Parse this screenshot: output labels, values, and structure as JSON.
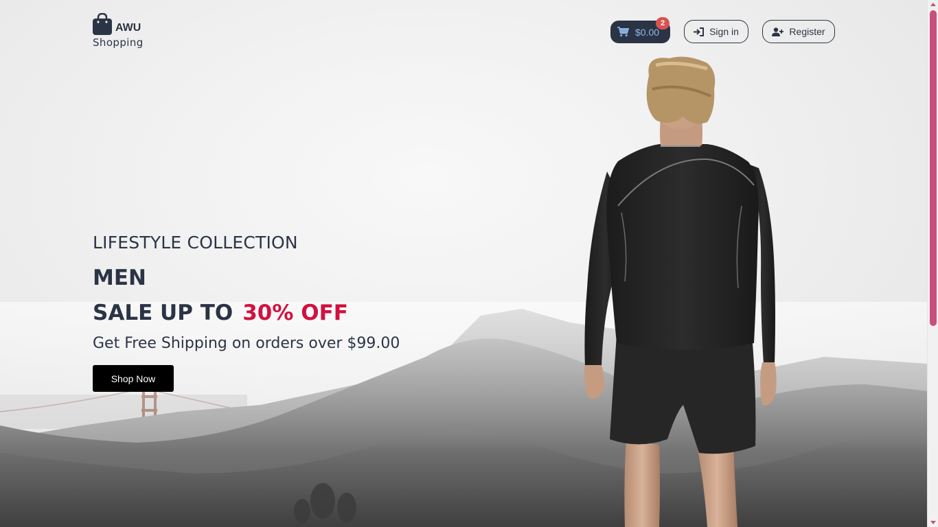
{
  "header": {
    "brand": "AWU",
    "brand_sub": "Shopping",
    "cart_total": "$0.00",
    "cart_count": "2",
    "signin_label": "Sign in",
    "register_label": "Register"
  },
  "hero": {
    "eyebrow": "LIFESTYLE COLLECTION",
    "title": "MEN",
    "sale_prefix": "SALE UP TO",
    "sale_highlight": "30% OFF",
    "shipping_text": "Get Free Shipping on orders over $99.00",
    "cta_label": "Shop Now"
  },
  "colors": {
    "primary_dark": "#2b3445",
    "accent_red": "#d11140",
    "badge_red": "#d9534f",
    "cart_text": "#8fb8e8",
    "scrollbar": "#c94f7c"
  },
  "icons": {
    "logo": "shopping-bag-icon",
    "cart": "shopping-cart-icon",
    "signin": "sign-in-icon",
    "register": "user-plus-icon"
  }
}
